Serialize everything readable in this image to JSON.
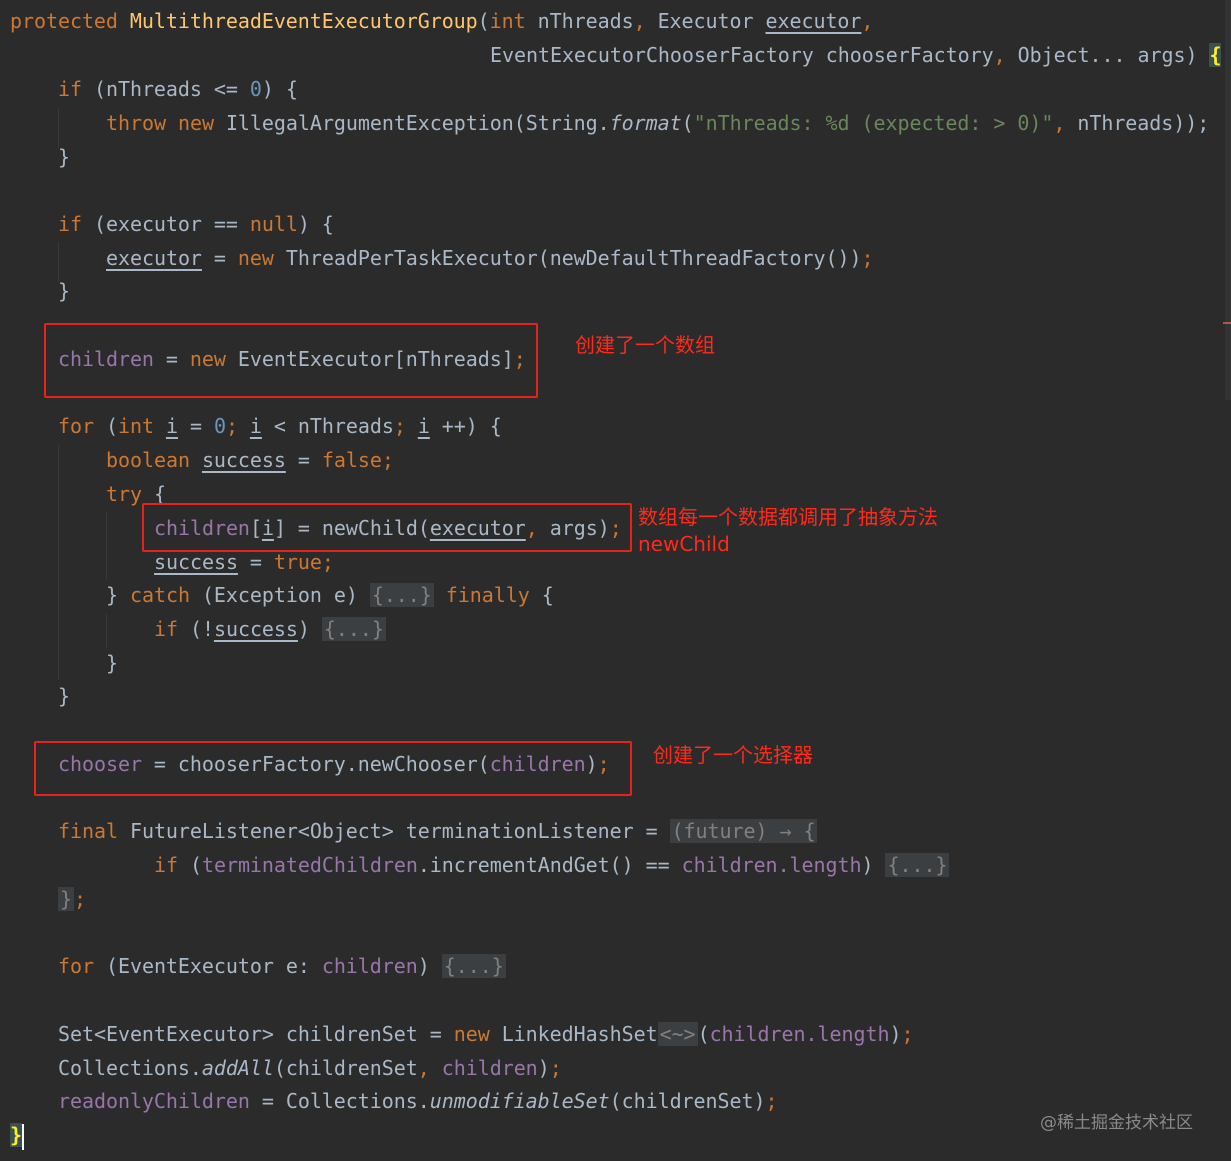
{
  "code": {
    "l1": {
      "mod": "protected",
      "name": "MultithreadEventExecutorGroup",
      "p1": "(",
      "t1": "int",
      "a1": " nThreads",
      "c1": ", ",
      "t2": "Executor ",
      "a2": "executor",
      "c2": ","
    },
    "l2": {
      "t3": "EventExecutorChooserFactory chooserFactory",
      "c3": ", ",
      "t4": "Object... args) ",
      "brace": "{"
    },
    "l3": {
      "kw": "if",
      "pre": " (nThreads <= ",
      "num": "0",
      "post": ") {"
    },
    "l4": {
      "kw1": "throw",
      "kw2": "new",
      "cls": " IllegalArgumentException(String.",
      "fmt": "format",
      "p": "(",
      "str": "\"nThreads: %d (expected: > 0)\"",
      "c": ", ",
      "rest": "nThreads));"
    },
    "l5": "}",
    "l6": {
      "kw": "if",
      "pre": " (executor == ",
      "nul": "null",
      "post": ") {"
    },
    "l7": {
      "var": "executor",
      "eq": " = ",
      "kw": "new",
      "rest": " ThreadPerTaskExecutor(newDefaultThreadFactory())",
      "semi": ";"
    },
    "l8": "}",
    "l9": {
      "fld": "children",
      "eq": " = ",
      "kw": "new",
      "rest": " EventExecutor[nThreads]",
      "semi": ";"
    },
    "l10": {
      "kw": "for",
      "p": " (",
      "t": "int",
      "sp": " ",
      "i1": "i",
      "eq": " = ",
      "n": "0",
      "sc1": "; ",
      "i2": "i",
      "lt": " < nThreads",
      "sc2": "; ",
      "i3": "i",
      "rest": " ++) {"
    },
    "l11": {
      "kw": "boolean",
      "sp": " ",
      "var": "success",
      "eq": " = ",
      "val": "false",
      "semi": ";"
    },
    "l12": {
      "kw": "try",
      "rest": " {"
    },
    "l13": {
      "fld": "children",
      "b1": "[",
      "i": "i",
      "b2": "]",
      "eq": " = newChild(",
      "ex": "executor",
      "c": ", ",
      "rest": "args)",
      "semi": ";"
    },
    "l14": {
      "var": "success",
      "eq": " = ",
      "val": "true",
      "semi": ";"
    },
    "l15": {
      "b": "} ",
      "kw1": "catch",
      "mid": " (Exception e) ",
      "fold": "{...}",
      "sp": " ",
      "kw2": "finally",
      "rest": " {"
    },
    "l16": {
      "kw": "if",
      "pre": " (!",
      "var": "success",
      "post": ") ",
      "fold": "{...}"
    },
    "l17": "}",
    "l18": "}",
    "l19": {
      "fld": "chooser",
      "eq": " = chooserFactory.newChooser(",
      "fld2": "children",
      "rest": ")",
      "semi": ";"
    },
    "l20": {
      "kw": "final",
      "rest": " FutureListener<Object> terminationListener = ",
      "fold": "(future) → {"
    },
    "l21": {
      "kw": "if",
      "p": " (",
      "fld": "terminatedChildren",
      "mid": ".incrementAndGet() == ",
      "fld2": "children",
      "len": ".length",
      "post": ") ",
      "fold": "{...}"
    },
    "l22": {
      "fold": "}",
      "semi": ";"
    },
    "l23": {
      "kw": "for",
      "mid": " (EventExecutor e: ",
      "fld": "children",
      "post": ") ",
      "fold": "{...}"
    },
    "l24": {
      "pre": "Set<EventExecutor> childrenSet = ",
      "kw": "new",
      "cls": " LinkedHashSet",
      "fold": "<~>",
      "p": "(",
      "fld": "children",
      "len": ".length",
      "post": ")",
      "semi": ";"
    },
    "l25": {
      "pre": "Collections.",
      "fn": "addAll",
      "p": "(childrenSet",
      "c": ", ",
      "fld": "children",
      "post": ")",
      "semi": ";"
    },
    "l26": {
      "fld": "readonlyChildren",
      "eq": " = Collections.",
      "fn": "unmodifiableSet",
      "post": "(childrenSet)",
      "semi": ";"
    },
    "l27": "}"
  },
  "annotations": {
    "array": "创建了一个数组",
    "newchild_1": "数组每一个数据都调用了抽象方法",
    "newchild_2": "newChild",
    "chooser": "创建了一个选择器"
  },
  "watermark": "@稀土掘金技术社区",
  "colors": {
    "background": "#2b2b2b",
    "keyword": "#cc7832",
    "method": "#ffc66d",
    "string": "#6a8759",
    "number": "#6897bb",
    "field": "#9876aa",
    "annotation": "#e5231b"
  }
}
